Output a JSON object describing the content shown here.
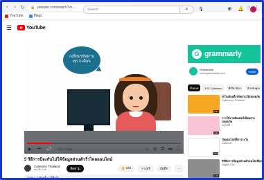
{
  "browser": {
    "url": "youtube.com/watch?v=...",
    "bookmarks": [
      {
        "label": "YouTube"
      },
      {
        "label": "Maps"
      }
    ]
  },
  "header": {
    "logo_text": "YouTube",
    "search_placeholder": "Search"
  },
  "player": {
    "bubble_line1": "เปลี่ยนรหัสผ่าน",
    "bubble_line2": "ทุก 3 เดือน",
    "time": "0:12 / 1:05",
    "progress": 0.16
  },
  "video": {
    "title": "5 วิธีการป้องกันไม่ให้ข้อมูลส่วนตัวรั่วไหลออนไลน์",
    "channel": "Cybersec Thailand",
    "subscribers": "สมาชิก 12K",
    "subscribe_label": "ติดตาม",
    "likes": "246",
    "share_label": "แชร์",
    "save_label": "บันทึก",
    "more_label": "...",
    "description": "การดู 1.2 พันครั้ง  1 ปีที่แล้ว"
  },
  "sidebar": {
    "ad": {
      "brand": "grammarly",
      "title": "Grammarly",
      "url": "www.grammarly.com",
      "cta": "Install"
    },
    "chips": [
      "ทั้งหมด",
      "จาก Cybersec",
      "ที่เกี่ยวข้อง",
      "สำหรับคุณ"
    ],
    "recommendations": [
      {
        "title": "ทำไมต้องตั้งรหัสผ่านให้ปลอดภัย",
        "channel": "Cybersec Thailand",
        "duration": "3:21",
        "color": "#f6a623"
      },
      {
        "title": "การใช้งานอินเทอร์เน็ตอย่างปลอดภัย",
        "channel": "ครูไอที",
        "duration": "4:10",
        "color": "#f9c3d3"
      },
      {
        "title": "ภัยออนไลน์ที่ควรระวัง",
        "channel": "SafeNet",
        "duration": "5:02",
        "color": "#ffffff"
      },
      {
        "title": "วิธีจัดการข้อมูลส่วนตัวบนโซเชียล",
        "channel": "Digital Life",
        "duration": "2:48",
        "color": "#8d8d8d"
      }
    ]
  }
}
